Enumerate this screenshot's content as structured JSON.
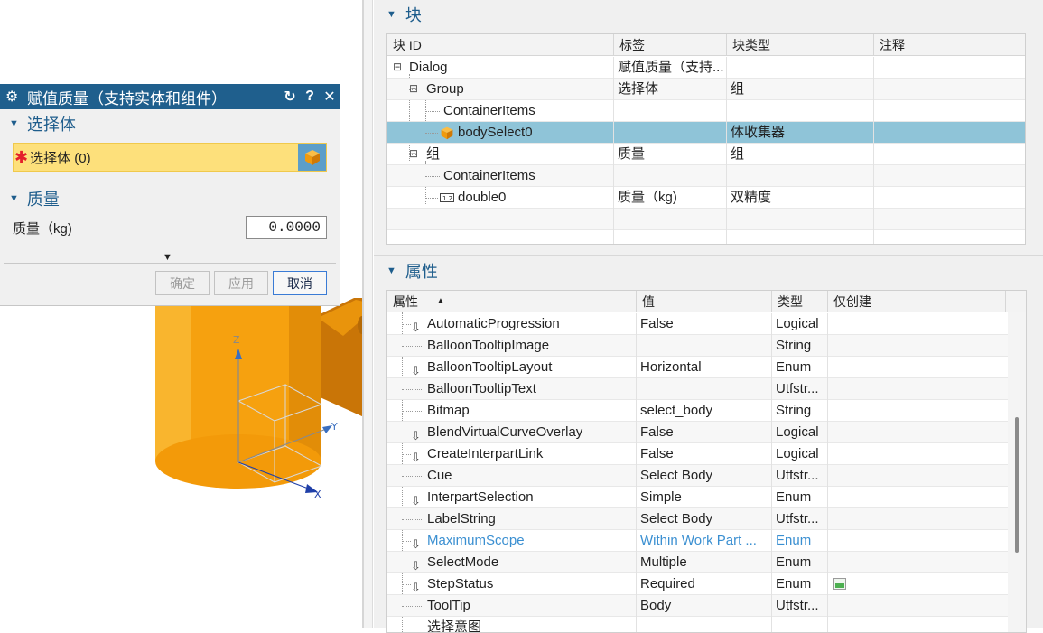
{
  "dialog": {
    "title": "赋值质量（支持实体和组件）",
    "sections": {
      "select_body": "选择体",
      "mass": "质量"
    },
    "select_row_label": "选择体 (0)",
    "mass_label": "质量（kg)",
    "mass_value": "0.0000",
    "buttons": {
      "ok": "确定",
      "apply": "应用",
      "cancel": "取消"
    }
  },
  "viewport": {
    "axes": {
      "x": "X",
      "y": "Y",
      "z": "Z"
    },
    "colors": {
      "body": "#f5a10e",
      "body_dark": "#d47f06"
    }
  },
  "block_section": {
    "title": "块",
    "columns": [
      "块 ID",
      "标签",
      "块类型",
      "注释"
    ],
    "rows": [
      {
        "id": "Dialog",
        "label": "赋值质量（支持...",
        "type": "",
        "note": ""
      },
      {
        "id": "Group",
        "label": "选择体",
        "type": "组",
        "note": ""
      },
      {
        "id": "ContainerItems",
        "label": "",
        "type": "",
        "note": ""
      },
      {
        "id": "bodySelect0",
        "label": "",
        "type": "体收集器",
        "note": ""
      },
      {
        "id": "组",
        "label": "质量",
        "type": "组",
        "note": ""
      },
      {
        "id": "ContainerItems",
        "label": "",
        "type": "",
        "note": ""
      },
      {
        "id": "double0",
        "label": "质量（kg)",
        "type": "双精度",
        "note": ""
      }
    ]
  },
  "property_section": {
    "title": "属性",
    "columns": [
      "属性",
      "值",
      "类型",
      "仅创建"
    ],
    "rows": [
      {
        "name": "AutomaticProgression",
        "value": "False",
        "type": "Logical",
        "arrow": true
      },
      {
        "name": "BalloonTooltipImage",
        "value": "",
        "type": "String",
        "arrow": false
      },
      {
        "name": "BalloonTooltipLayout",
        "value": "Horizontal",
        "type": "Enum",
        "arrow": true
      },
      {
        "name": "BalloonTooltipText",
        "value": "",
        "type": "Utfstr...",
        "arrow": false
      },
      {
        "name": "Bitmap",
        "value": "select_body",
        "type": "String",
        "arrow": false
      },
      {
        "name": "BlendVirtualCurveOverlay",
        "value": "False",
        "type": "Logical",
        "arrow": true
      },
      {
        "name": "CreateInterpartLink",
        "value": "False",
        "type": "Logical",
        "arrow": true
      },
      {
        "name": "Cue",
        "value": "Select Body",
        "type": "Utfstr...",
        "arrow": false
      },
      {
        "name": "InterpartSelection",
        "value": "Simple",
        "type": "Enum",
        "arrow": true
      },
      {
        "name": "LabelString",
        "value": "Select Body",
        "type": "Utfstr...",
        "arrow": false
      },
      {
        "name": "MaximumScope",
        "value": "Within Work Part ...",
        "type": "Enum",
        "arrow": true
      },
      {
        "name": "SelectMode",
        "value": "Multiple",
        "type": "Enum",
        "arrow": true
      },
      {
        "name": "StepStatus",
        "value": "Required",
        "type": "Enum",
        "arrow": true
      },
      {
        "name": "ToolTip",
        "value": "Body",
        "type": "Utfstr...",
        "arrow": false
      },
      {
        "name": "选择意图",
        "value": "",
        "type": "",
        "arrow": false
      }
    ]
  }
}
